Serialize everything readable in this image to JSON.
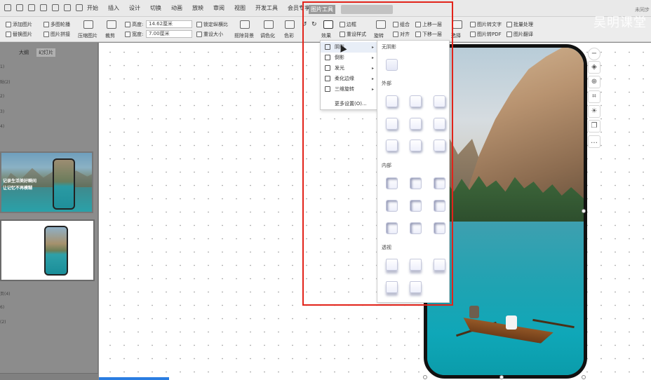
{
  "watermark": "吴明课堂",
  "top_right_status": "未同步",
  "menu": {
    "tabs": [
      "开始",
      "插入",
      "设计",
      "切换",
      "动画",
      "放映",
      "审阅",
      "视图",
      "开发工具",
      "会员专享"
    ],
    "active_tool_tab": "图片工具"
  },
  "ribbon": {
    "add_picture": "添加图片",
    "multi_outline": "多图轮播",
    "replace_picture": "替换图片",
    "picture_collage": "图片拼接",
    "compress_picture": "压缩图片",
    "crop": "裁剪",
    "height_label": "高度:",
    "height_value": "14.62厘米",
    "width_label": "宽度:",
    "width_value": "7.00厘米",
    "lock_ratio": "锁定纵横比",
    "reset_size": "重设大小",
    "remove_bg": "抠除背景",
    "color_adjust": "调色化",
    "color": "色彩",
    "effects": "效果",
    "border": "边框",
    "reset_style": "重设样式",
    "rotate": "旋转",
    "group": "组合",
    "align": "对齐",
    "bring_forward": "上移一层",
    "send_backward": "下移一层",
    "select": "选择",
    "picture_to_text": "图片转文字",
    "batch_process": "批量处理",
    "picture_to_pdf": "图片转PDF",
    "picture_translate": "图片翻译"
  },
  "left_panel": {
    "tabs": [
      "大纲",
      "幻灯片"
    ],
    "active_tab": "幻灯片",
    "outline_numbers": [
      "1)",
      "贴(2)",
      "2)",
      "3)",
      "4)",
      "5)",
      "页(4)",
      "6)",
      "(2)"
    ],
    "slide1_line1": "记录生活美好瞬间",
    "slide1_line2": "让记忆不再模糊"
  },
  "effect_menu": {
    "items": [
      "阴影",
      "倒影",
      "发光",
      "柔化边缘",
      "三维旋转"
    ],
    "more": "更多设置(O)..."
  },
  "shadow_gallery": {
    "no_shadow": "无阴影",
    "outer": "外部",
    "inner": "内部",
    "perspective": "透视"
  }
}
